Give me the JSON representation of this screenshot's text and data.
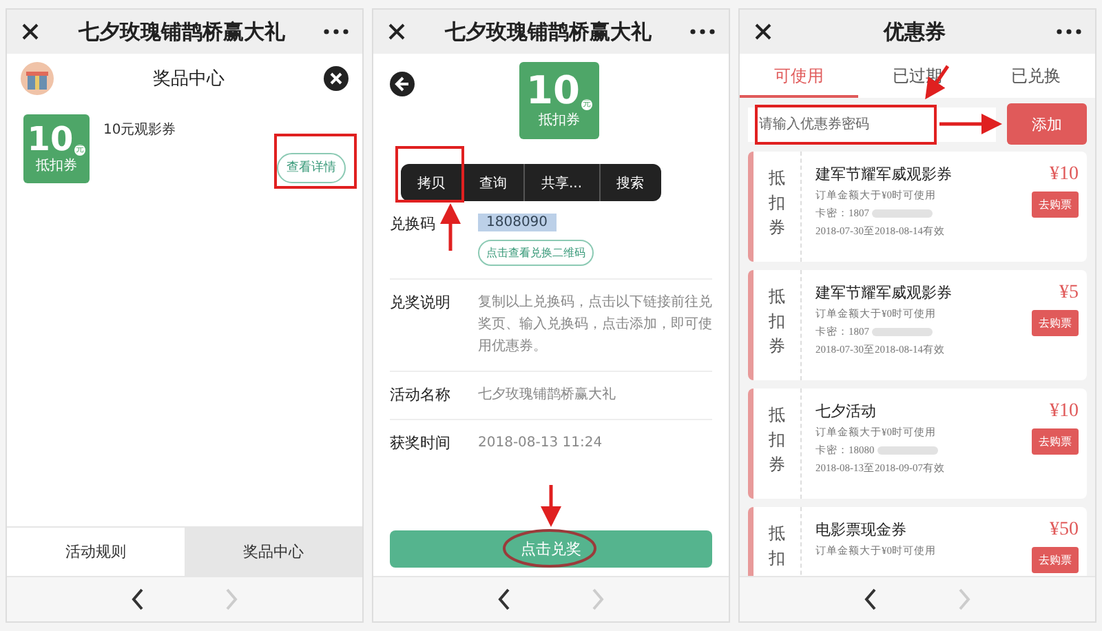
{
  "left_screen": {
    "header": {
      "title": "七夕玫瑰铺鹊桥赢大礼"
    },
    "subheader": {
      "title": "奖品中心"
    },
    "prizes": [
      {
        "ticket": {
          "value": "10",
          "unit": "元",
          "label": "抵扣券"
        },
        "name": "10元观影券",
        "button": "查看详情"
      }
    ],
    "bottom_tabs": [
      {
        "label": "活动规则",
        "selected": false
      },
      {
        "label": "奖品中心",
        "selected": true
      }
    ],
    "nav": {
      "forward_disabled": true
    }
  },
  "middle_screen": {
    "header": {
      "title": "七夕玫瑰铺鹊桥赢大礼"
    },
    "ticket": {
      "value": "10",
      "unit": "元",
      "label": "抵扣券"
    },
    "context_menu": [
      "拷贝",
      "查询",
      "共享...",
      "搜索"
    ],
    "fields": [
      {
        "kind": "code",
        "label": "兑换码",
        "value": "1808090",
        "button": "点击查看兑换二维码"
      },
      {
        "kind": "text",
        "label": "兑奖说明",
        "value": "复制以上兑换码，点击以下链接前往兑奖页、输入兑换码，点击添加，即可使用优惠券。"
      },
      {
        "kind": "text",
        "label": "活动名称",
        "value": "七夕玫瑰铺鹊桥赢大礼"
      },
      {
        "kind": "text",
        "label": "获奖时间",
        "value": "2018-08-13 11:24"
      }
    ],
    "action_button": "点击兑奖",
    "nav": {
      "forward_disabled": true
    }
  },
  "right_screen": {
    "header": {
      "title": "优惠券"
    },
    "tabs": [
      {
        "label": "可使用",
        "selected": true
      },
      {
        "label": "已过期",
        "selected": false
      },
      {
        "label": "已兑换",
        "selected": false
      }
    ],
    "code_field": {
      "placeholder": "请输入优惠券密码"
    },
    "add_button": "添加",
    "coupons": [
      {
        "type": "抵扣券",
        "title": "建军节耀军威观影券",
        "condition": "订单金额大于¥0时可使用",
        "card": "卡密：1807",
        "validity": "2018-07-30至2018-08-14有效",
        "price": "¥10",
        "button": "去购票"
      },
      {
        "type": "抵扣券",
        "title": "建军节耀军威观影券",
        "condition": "订单金额大于¥0时可使用",
        "card": "卡密：1807",
        "validity": "2018-07-30至2018-08-14有效",
        "price": "¥5",
        "button": "去购票"
      },
      {
        "type": "抵扣券",
        "title": "七夕活动",
        "condition": "订单金额大于¥0时可使用",
        "card": "卡密：18080",
        "validity": "2018-08-13至2018-09-07有效",
        "price": "¥10",
        "button": "去购票"
      },
      {
        "type": "抵扣",
        "title": "电影票现金券",
        "condition": "订单金额大于¥0时可使用",
        "price": "¥50",
        "button": "去购票"
      }
    ],
    "nav": {
      "forward_disabled": true
    }
  }
}
